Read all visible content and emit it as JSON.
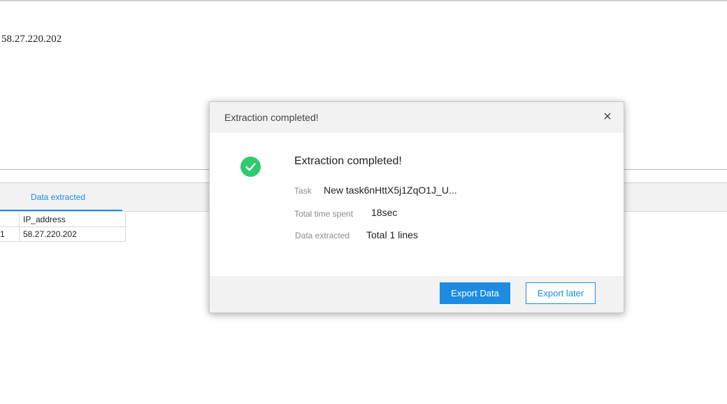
{
  "page": {
    "ip_text": "58.27.220.202"
  },
  "tabs": {
    "data_extracted_label": "Data extracted"
  },
  "table": {
    "columns": [
      "IP_address"
    ],
    "rows": [
      {
        "index": "1",
        "ip": "58.27.220.202"
      }
    ]
  },
  "dialog": {
    "title": "Extraction completed!",
    "heading": "Extraction completed!",
    "task_label": "Task",
    "task_value": "New task6nHttX5j1ZqO1J_U...",
    "time_label": "Total time spent",
    "time_value": "18sec",
    "data_label": "Data extracted",
    "data_value": "Total 1 lines",
    "export_button": "Export Data",
    "later_button": "Export later",
    "close_symbol": "×"
  },
  "icons": {
    "success": "check-circle-icon",
    "close": "close-icon"
  },
  "colors": {
    "accent": "#1d8ce0",
    "success": "#2fcb6f"
  }
}
